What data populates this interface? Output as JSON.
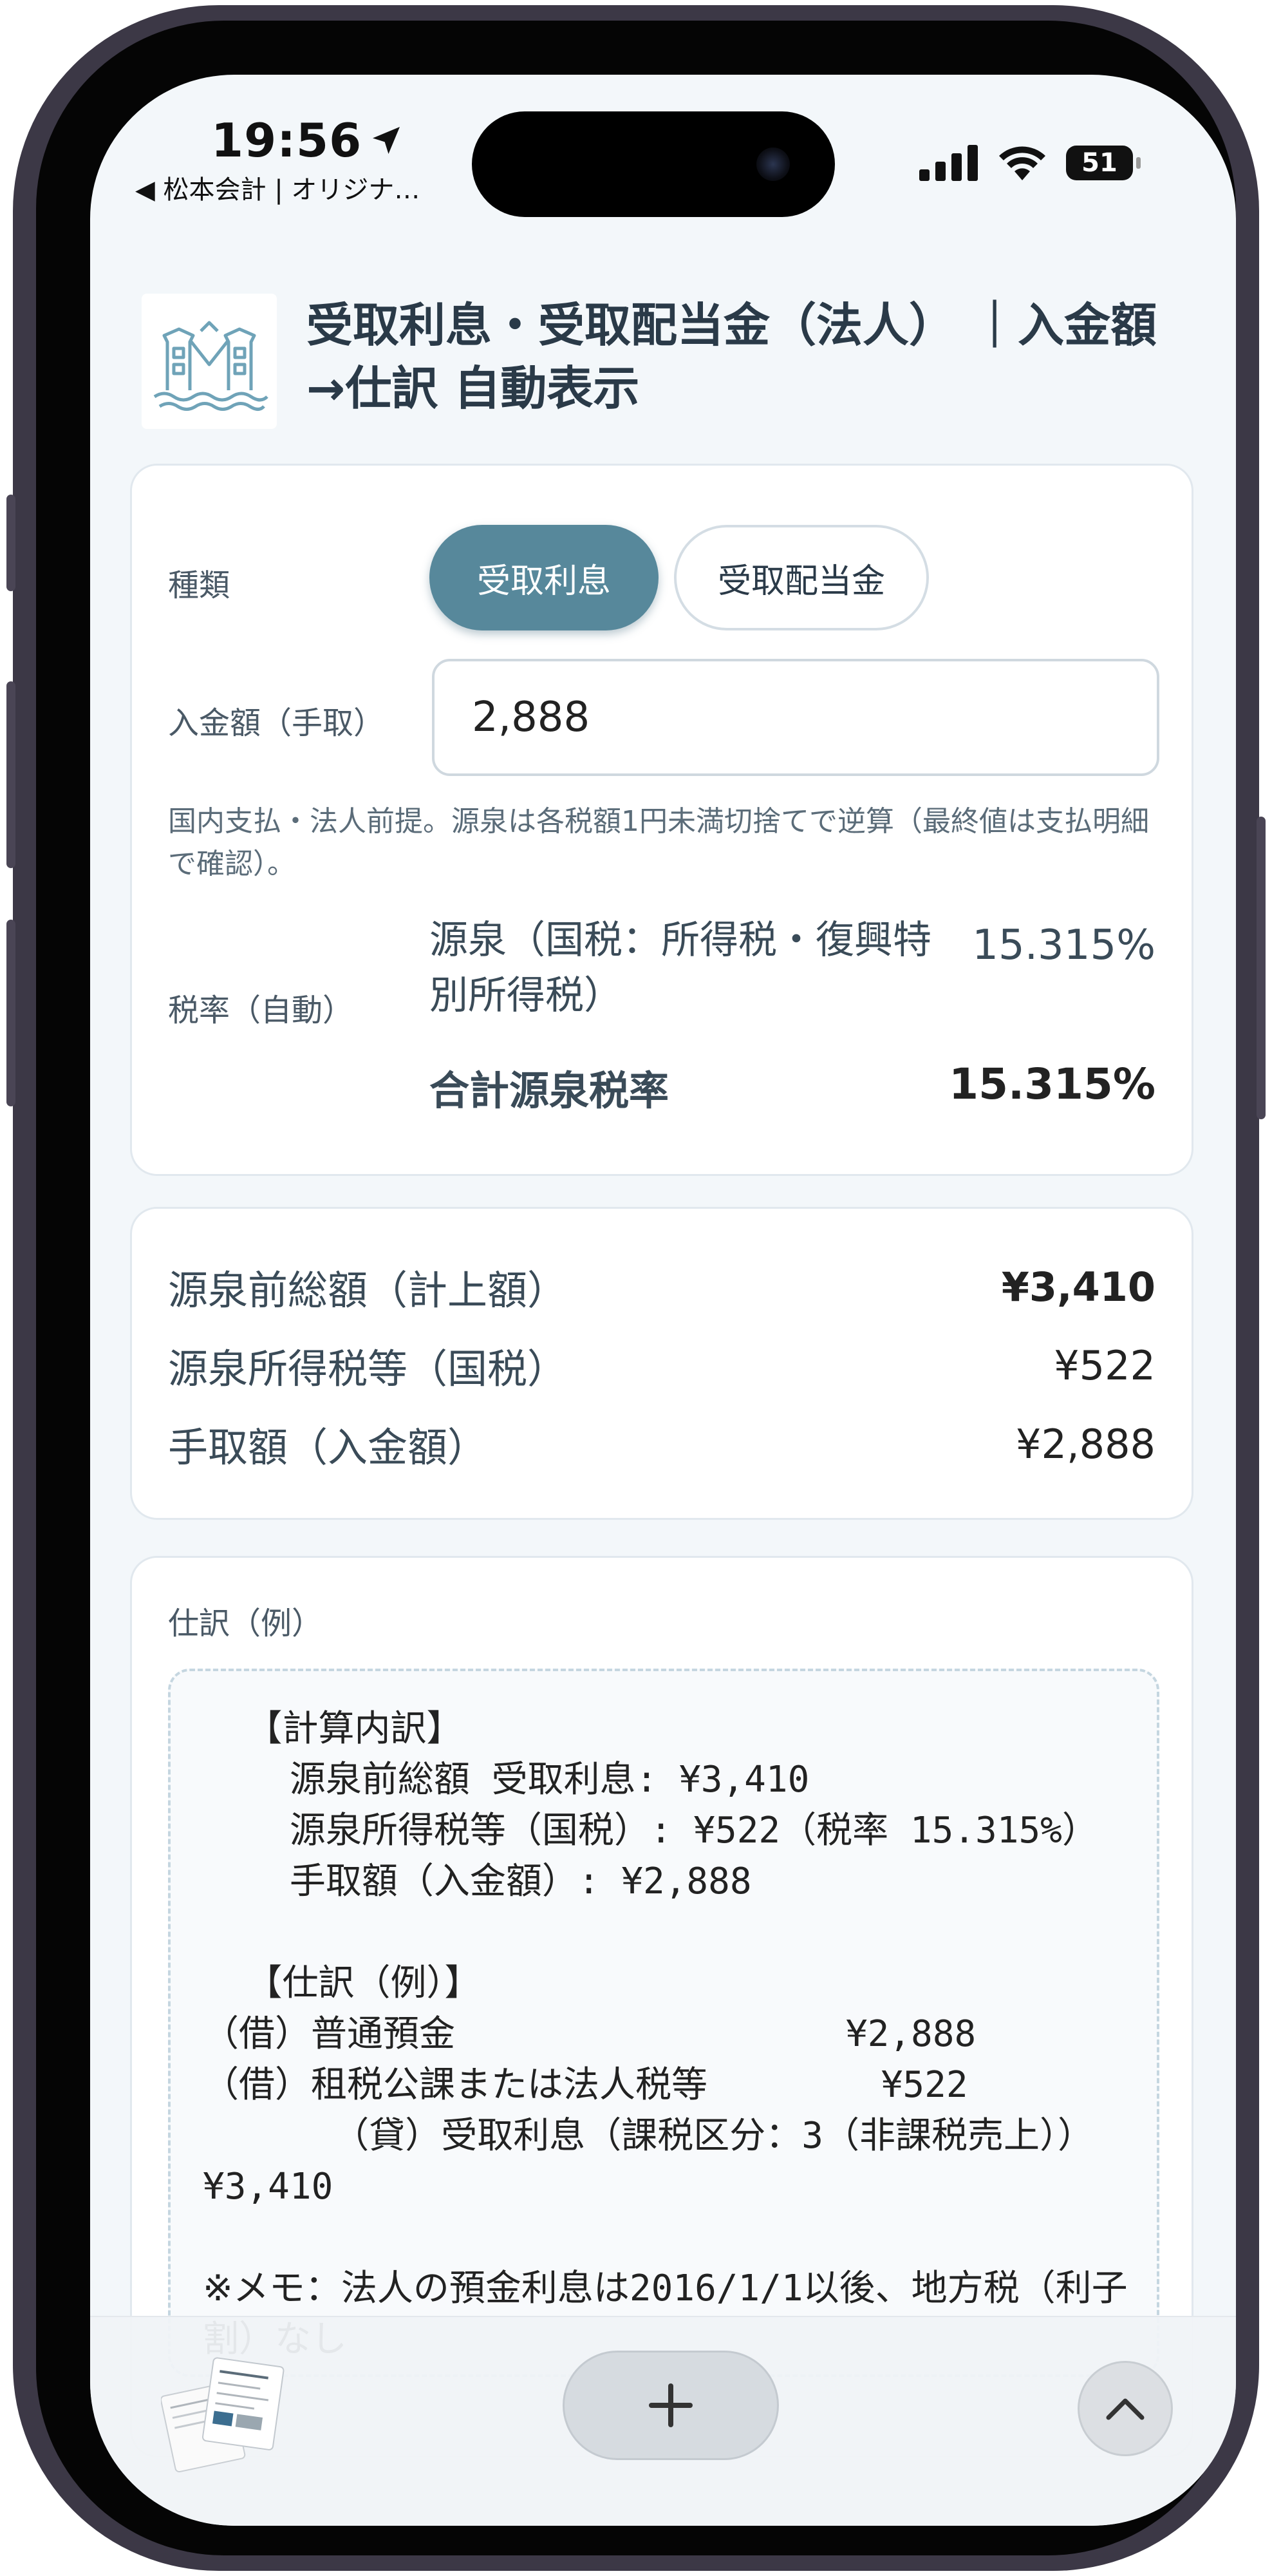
{
  "status_bar": {
    "time": "19:56",
    "back_app": "◀ 松本会計 | オリジナ…",
    "battery": "51"
  },
  "header": {
    "title": "受取利息・受取配当金（法人） ｜入金額→仕訳 自動表示"
  },
  "input_card": {
    "type_label": "種類",
    "type_options": [
      "受取利息",
      "受取配当金"
    ],
    "selected_type": "受取利息",
    "amount_label": "入金額（手取）",
    "amount_value": "2,888",
    "note": "国内支払・法人前提。源泉は各税額1円未満切捨てで逆算（最終値は支払明細で確認）。",
    "rate_label": "税率（自動）",
    "rate_name": "源泉（国税：所得税・復興特別所得税）",
    "rate_value": "15.315%",
    "total_rate_label": "合計源泉税率",
    "total_rate_value": "15.315%"
  },
  "summary_card": {
    "rows": [
      {
        "label": "源泉前総額（計上額）",
        "value": "¥3,410"
      },
      {
        "label": "源泉所得税等（国税）",
        "value": "¥522"
      },
      {
        "label": "手取額（入金額）",
        "value": "¥2,888"
      }
    ]
  },
  "journal_card": {
    "label": "仕訳（例）",
    "text": "  【計算内訳】\n    源泉前総額 受取利息: ¥3,410\n    源泉所得税等（国税）: ¥522（税率 15.315%）\n    手取額（入金額）: ¥2,888\n\n  【仕訳（例）】\n（借）普通預金                  ¥2,888\n（借）租税公課または法人税等        ¥522\n      （貸）受取利息（課税区分：3（非課税売上）） ¥3,410\n\n※メモ：法人の預金利息は2016/1/1以後、地方税（利子割）なし"
  },
  "toolbar": {
    "new_tab_icon": "plus-icon",
    "up_icon": "chevron-up-icon",
    "tabs_icon": "tab-thumbnails-icon"
  },
  "colors": {
    "accent": "#57889b",
    "background": "#f3f7fa",
    "text": "#2a3a48"
  }
}
